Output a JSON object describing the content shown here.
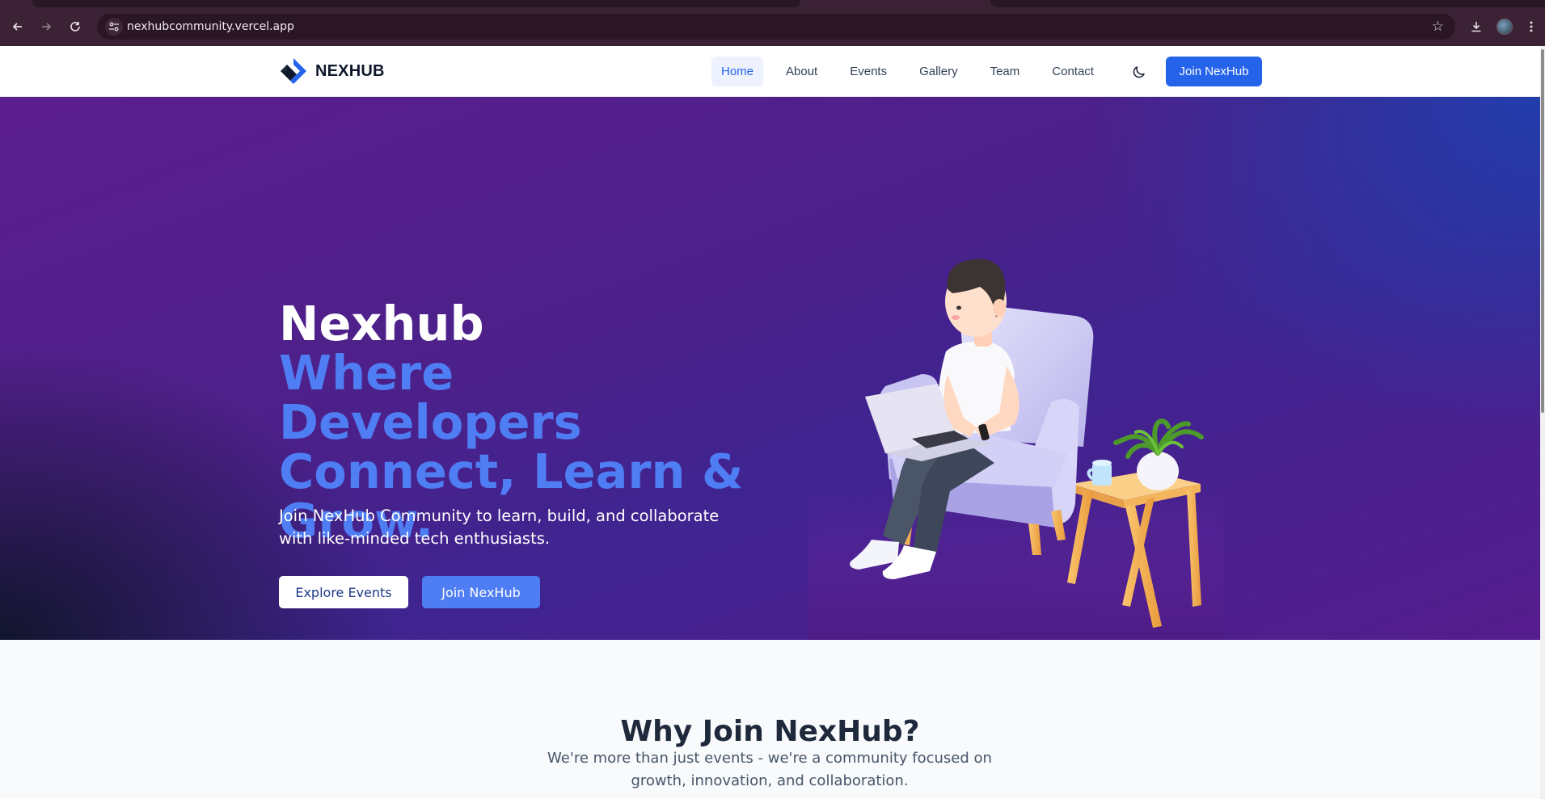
{
  "browser": {
    "url": "nexhubcommunity.vercel.app",
    "icons": [
      "back-icon",
      "forward-icon",
      "reload-icon",
      "site-info-icon",
      "bookmark-star-icon",
      "download-icon",
      "profile-avatar",
      "menu-icon"
    ]
  },
  "header": {
    "brand": "NEXHUB",
    "nav": [
      {
        "label": "Home",
        "active": true
      },
      {
        "label": "About",
        "active": false
      },
      {
        "label": "Events",
        "active": false
      },
      {
        "label": "Gallery",
        "active": false
      },
      {
        "label": "Team",
        "active": false
      },
      {
        "label": "Contact",
        "active": false
      }
    ],
    "theme_icon": "moon-icon",
    "cta": "Join NexHub"
  },
  "hero": {
    "title": "Nexhub",
    "tagline": "Where Developers Connect, Learn & Grow.",
    "subtitle": "Join NexHub Community to learn, build, and collaborate with like-minded tech enthusiasts.",
    "primary_button": "Explore Events",
    "secondary_button": "Join NexHub"
  },
  "why": {
    "title": "Why Join NexHub?",
    "description": "We're more than just events - we're a community focused on growth, innovation, and collaboration."
  },
  "colors": {
    "accent": "#2563eb",
    "tagline": "#4f7df3",
    "hero_purple": "#4c2089",
    "heading": "#1e293b"
  }
}
